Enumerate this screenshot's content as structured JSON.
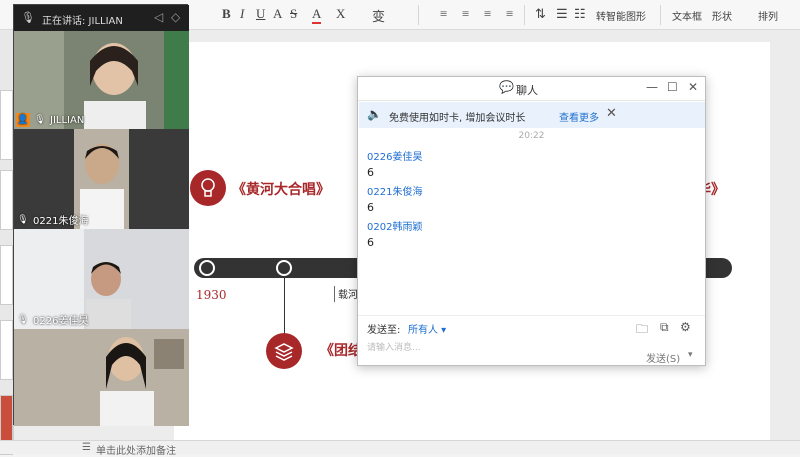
{
  "ribbon": {
    "items": [
      "B",
      "I",
      "U",
      "A",
      "S",
      "A",
      "X",
      "变"
    ],
    "right_items": [
      "转智能图形",
      "文本框",
      "形状",
      "排列"
    ]
  },
  "video": {
    "speaking_label": "正在讲话: JILLIAN",
    "participants": [
      {
        "name": "JILLIAN"
      },
      {
        "name": "0221朱俊海"
      },
      {
        "name": "0226姜佳昊"
      },
      {
        "name": ""
      }
    ]
  },
  "slide": {
    "title1": "《黄河大合唱》",
    "title2": "《团结",
    "title3": "华》",
    "year": "1930",
    "label_box": "载河"
  },
  "chat": {
    "title": "聊人",
    "notice_text": "免费使用如时卡, 增加会议时长",
    "notice_link": "查看更多",
    "time_label": "20:22",
    "messages": [
      {
        "sender": "0226姜佳昊",
        "text": "6"
      },
      {
        "sender": "0221朱俊海",
        "text": "6"
      },
      {
        "sender": "0202韩雨颖",
        "text": "6"
      }
    ],
    "send_to_label": "发送至:",
    "recipient": "所有人",
    "input_placeholder": "请输入消息...",
    "send_button": "发送(S)"
  },
  "footer": {
    "note": "单击此处添加备注"
  },
  "colors": {
    "accent_red": "#a8282a",
    "link_blue": "#1f6fd1"
  }
}
